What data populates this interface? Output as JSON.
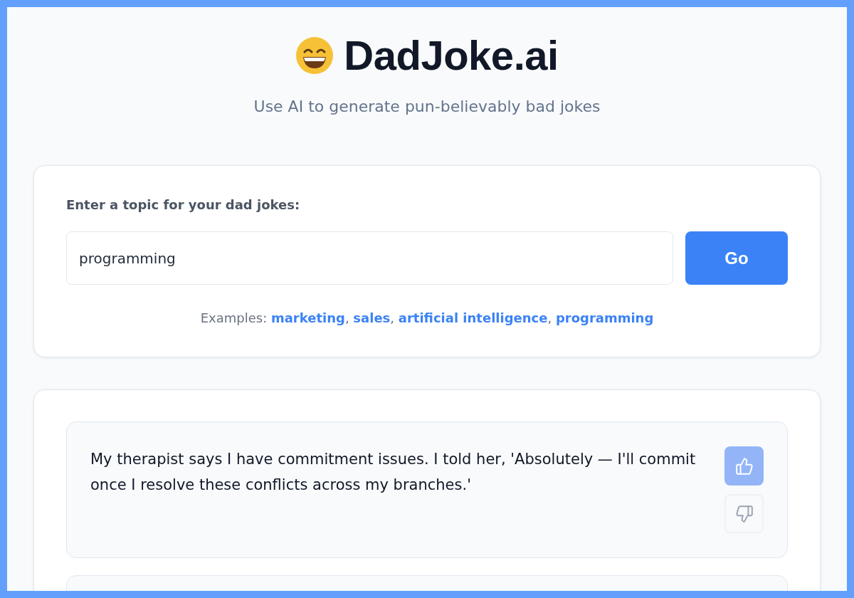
{
  "header": {
    "title": "DadJoke.ai",
    "subtitle": "Use AI to generate pun-believably bad jokes"
  },
  "topic_form": {
    "label": "Enter a topic for your dad jokes:",
    "value": "programming",
    "button": "Go",
    "examples_label": "Examples:",
    "examples": [
      {
        "label": "marketing",
        "separator": ","
      },
      {
        "label": "sales",
        "separator": ","
      },
      {
        "label": "artificial intelligence",
        "separator": ","
      },
      {
        "label": "programming"
      }
    ]
  },
  "jokes": [
    {
      "text": "My therapist says I have commitment issues. I told her, 'Absolutely — I'll commit once I resolve these conflicts across my branches.'",
      "votes": [
        {
          "kind": "up",
          "selected": true
        },
        {
          "kind": "down",
          "selected": false
        }
      ]
    }
  ],
  "more_jokes_below": true
}
